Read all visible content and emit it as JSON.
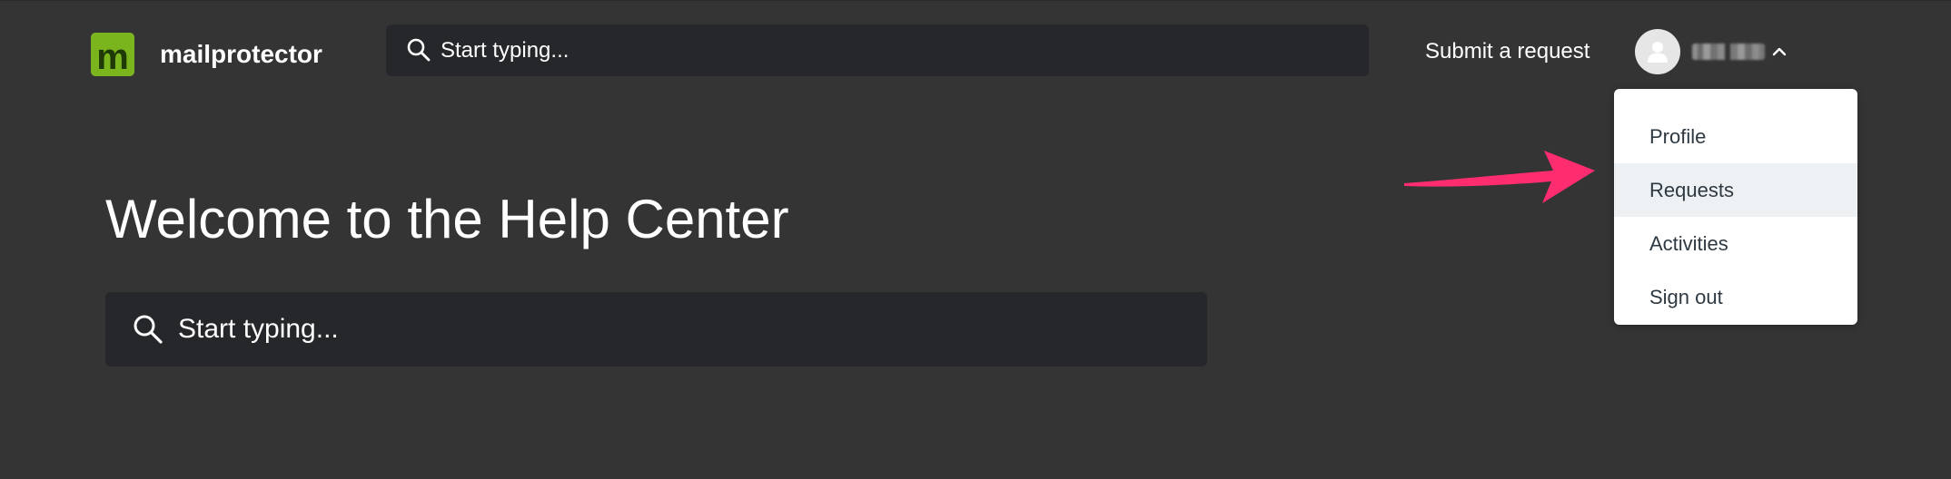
{
  "header": {
    "logo_letter": "m",
    "brand_name": "mailprotector",
    "search_placeholder": "Start typing...",
    "submit_request_label": "Submit a request",
    "user_name": "███ ████"
  },
  "user_menu": {
    "items": [
      {
        "label": "Profile"
      },
      {
        "label": "Requests"
      },
      {
        "label": "Activities"
      },
      {
        "label": "Sign out"
      }
    ],
    "highlighted_item": "Requests"
  },
  "hero": {
    "title": "Welcome to the Help Center",
    "search_placeholder": "Start typing..."
  },
  "colors": {
    "background": "#343434",
    "search_background": "#26272b",
    "logo_green": "#7ab51d",
    "annotation_arrow": "#ff2d6f",
    "menu_highlight": "#edf1f4",
    "menu_text": "#2f3941"
  },
  "icons": {
    "search": "search-icon",
    "avatar": "user-icon",
    "chevron": "chevron-up-icon",
    "annotation": "arrow-right-icon"
  }
}
